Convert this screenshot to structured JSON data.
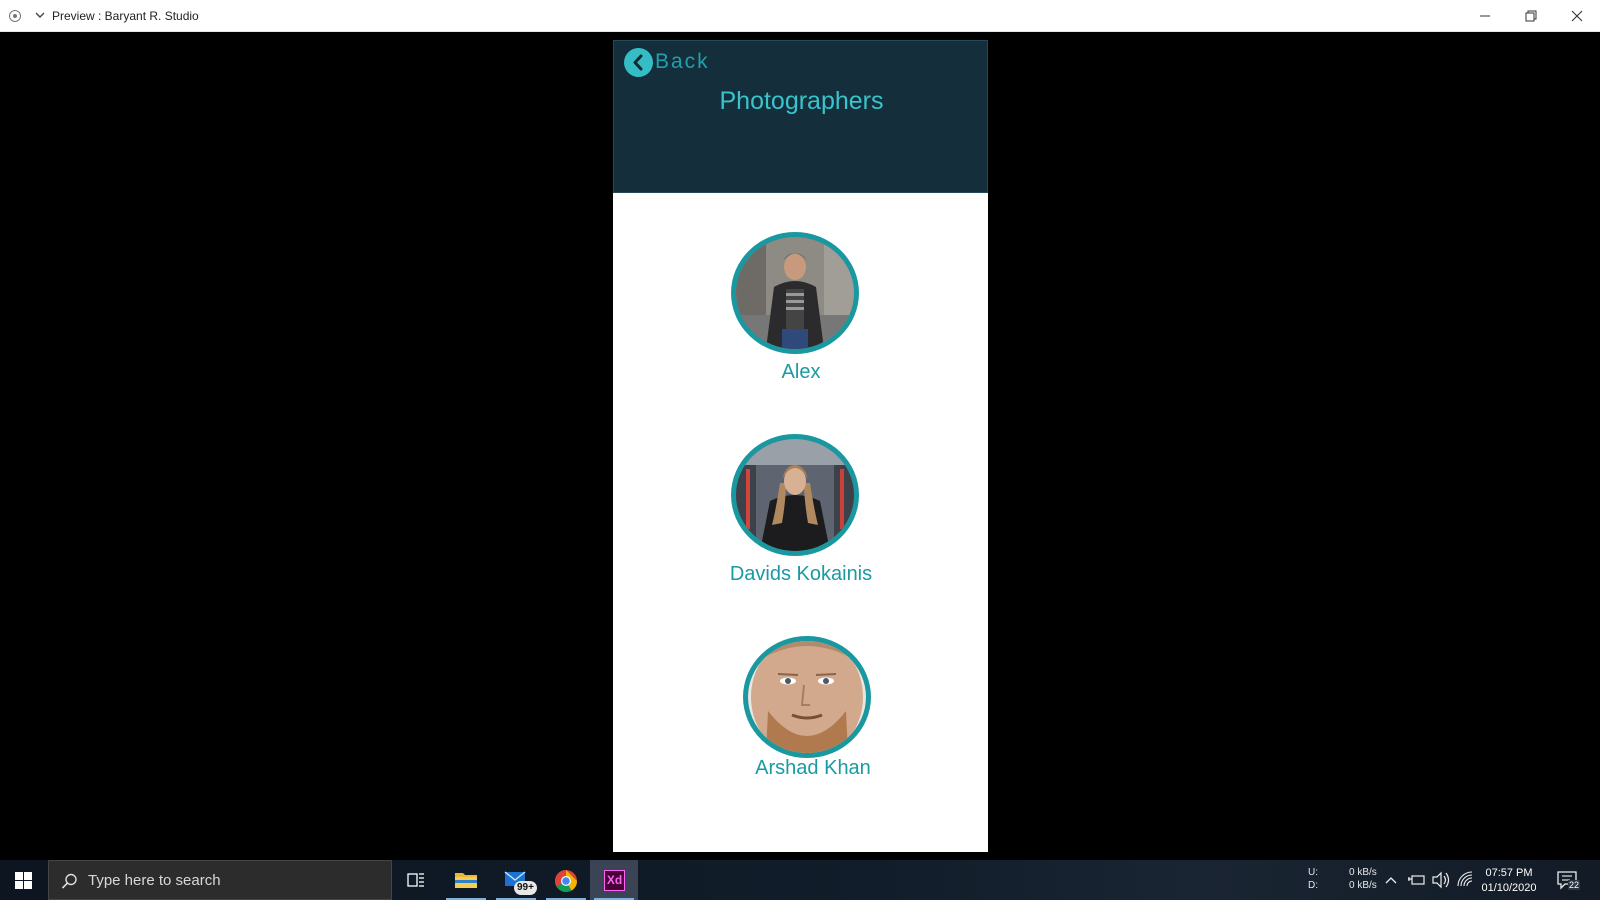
{
  "window": {
    "title": "Preview : Baryant R. Studio"
  },
  "app": {
    "back_label": "Back",
    "page_title": "Photographers",
    "header_bg": "#142f3b",
    "accent": "#1a98a0",
    "photographers": [
      {
        "name": "Alex"
      },
      {
        "name": "Davids Kokainis"
      },
      {
        "name": "Arshad Khan"
      }
    ]
  },
  "taskbar": {
    "search_placeholder": "Type here to search",
    "apps": [
      "task-view",
      "file-explorer",
      "mail",
      "chrome",
      "adobe-xd"
    ],
    "mail_badge": "99+",
    "xd_label": "Xd",
    "network": {
      "up_label": "U:",
      "down_label": "D:",
      "up_rate": "0 kB/s",
      "down_rate": "0 kB/s"
    },
    "time": "07:57 PM",
    "date": "01/10/2020",
    "notification_count": "22"
  }
}
